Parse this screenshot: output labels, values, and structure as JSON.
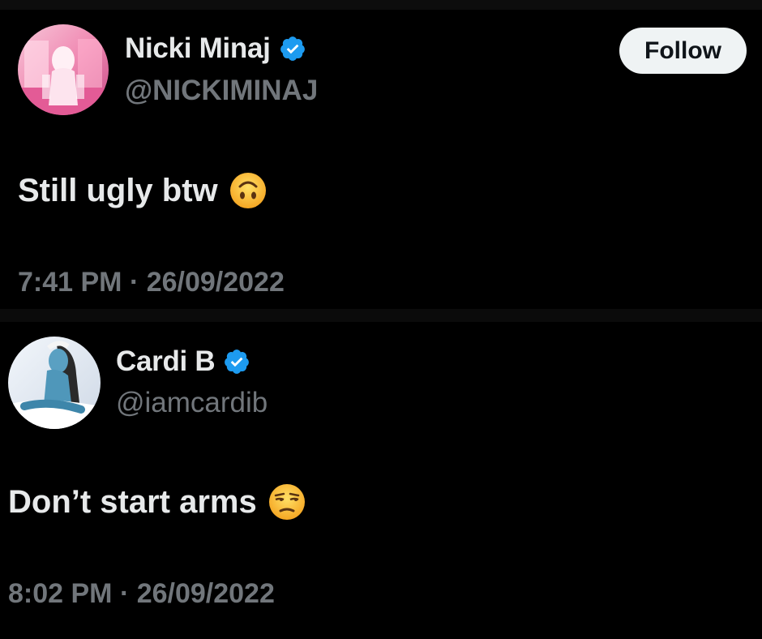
{
  "tweets": [
    {
      "name": "Nicki Minaj",
      "handle": "@NICKIMINAJ",
      "text": "Still ugly btw",
      "emoji": "upside-down-face",
      "timestamp": "7:41 PM · 26/09/2022",
      "follow_label": "Follow",
      "verified": true
    },
    {
      "name": "Cardi B",
      "handle": "@iamcardib",
      "text": "Don’t start arms",
      "emoji": "unamused-face",
      "timestamp": "8:02 PM · 26/09/2022",
      "verified": true
    }
  ],
  "colors": {
    "background": "#000000",
    "primary_text": "#e7e9ea",
    "secondary_text": "#71767b",
    "verified_blue": "#1d9bf0",
    "follow_bg": "#eff3f4"
  }
}
